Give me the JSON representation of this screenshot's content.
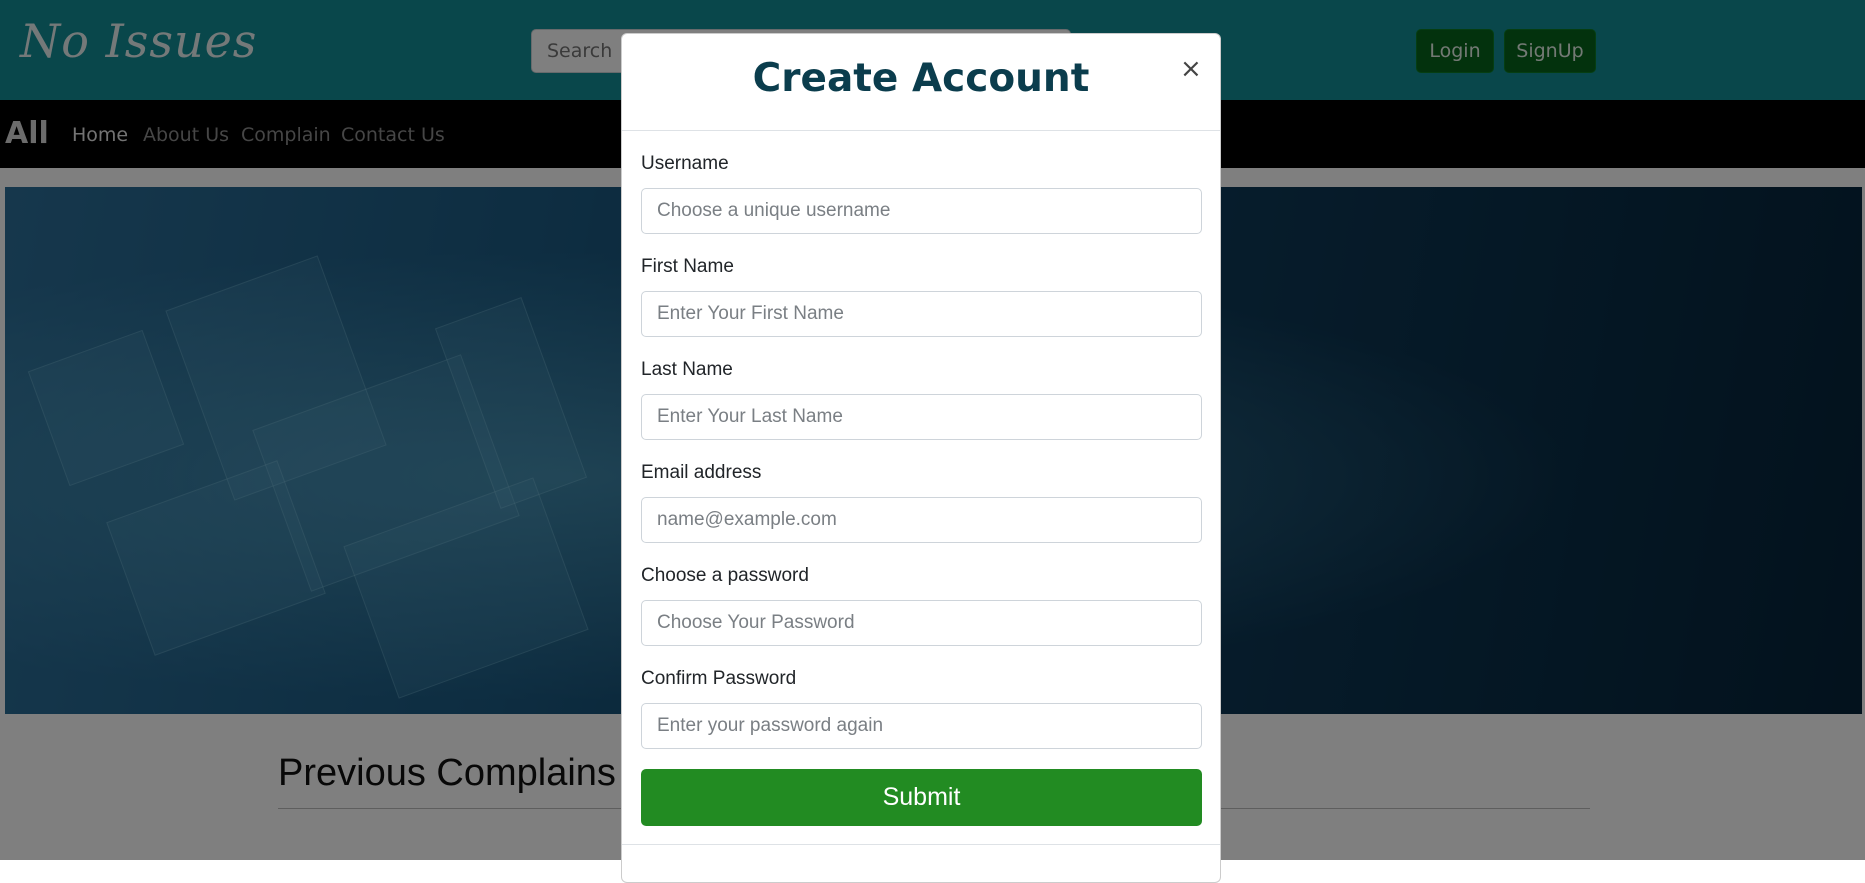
{
  "header": {
    "logo_text": "No Issues",
    "search": {
      "placeholder": "Search"
    },
    "login_label": "Login",
    "signup_label": "SignUp"
  },
  "nav": {
    "brand": "All",
    "links": [
      {
        "label": "Home",
        "active": true
      },
      {
        "label": "About Us"
      },
      {
        "label": "Complain"
      },
      {
        "label": "Contact Us"
      }
    ]
  },
  "main": {
    "section_title": "Previous Complains"
  },
  "modal": {
    "title": "Create Account",
    "close_glyph": "×",
    "fields": [
      {
        "label": "Username",
        "placeholder": "Choose a unique username",
        "value": ""
      },
      {
        "label": "First Name",
        "placeholder": "Enter Your First Name",
        "value": ""
      },
      {
        "label": "Last Name",
        "placeholder": "Enter Your Last Name",
        "value": ""
      },
      {
        "label": "Email address",
        "placeholder": "name@example.com",
        "value": ""
      },
      {
        "label": "Choose a password",
        "placeholder": "Choose Your Password",
        "value": ""
      },
      {
        "label": "Confirm Password",
        "placeholder": "Enter your password again",
        "value": ""
      }
    ],
    "submit_label": "Submit"
  },
  "colors": {
    "header_bg": "#138f96",
    "nav_bg": "#000000",
    "login_btn": "#06641a",
    "modal_title": "#0b3d4d",
    "submit_btn": "#228b22"
  }
}
